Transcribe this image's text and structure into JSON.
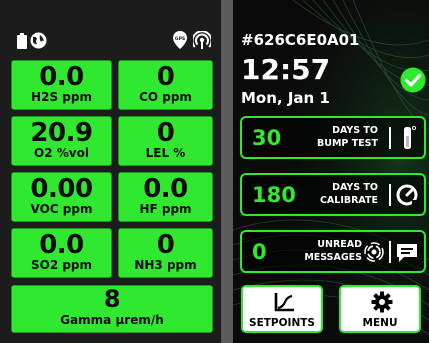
{
  "status_bar": {
    "left_icons": [
      "battery-icon",
      "globe-icon"
    ],
    "right_icons": [
      "gps-pin-icon",
      "wireless-signal-icon"
    ],
    "gps_label": "GPS"
  },
  "sensors": [
    {
      "value": "0.0",
      "unit": "H2S ppm"
    },
    {
      "value": "0",
      "unit": "CO ppm"
    },
    {
      "value": "20.9",
      "unit": "O2 %vol"
    },
    {
      "value": "0",
      "unit": "LEL %"
    },
    {
      "value": "0.00",
      "unit": "VOC ppm"
    },
    {
      "value": "0.0",
      "unit": "HF ppm"
    },
    {
      "value": "0.0",
      "unit": "SO2 ppm"
    },
    {
      "value": "0",
      "unit": "NH3 ppm"
    },
    {
      "value": "8",
      "unit": "Gamma µrem/h"
    }
  ],
  "device": {
    "id": "#626C6E0A01",
    "time": "12:57",
    "date": "Mon, Jan 1",
    "status_icon": "checkmark-circle-icon"
  },
  "info_boxes": [
    {
      "value": "30",
      "label_line1": "DAYS TO",
      "label_line2": "BUMP TEST",
      "icon": "bump-test-icon"
    },
    {
      "value": "180",
      "label_line1": "DAYS TO",
      "label_line2": "CALIBRATE",
      "icon": "calibrate-gauge-icon"
    },
    {
      "value": "0",
      "label_line1": "UNREAD",
      "label_line2": "MESSAGES",
      "icon": "message-icon"
    }
  ],
  "nav": {
    "setpoints_label": "SETPOINTS",
    "menu_label": "MENU"
  },
  "colors": {
    "accent_green": "#2fe82f",
    "tile_text": "#0d0d0d",
    "left_bg": "#1c1c1c",
    "divider": "#5a5a5a"
  }
}
